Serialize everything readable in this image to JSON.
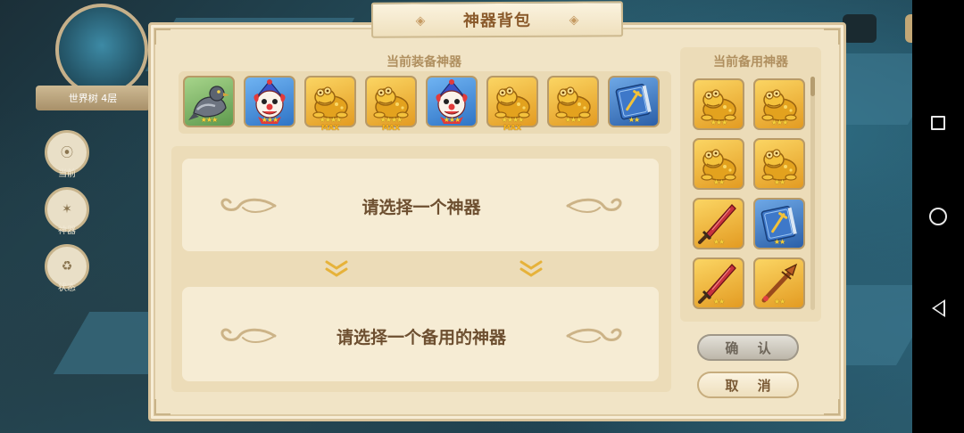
{
  "panel": {
    "title": "神器背包",
    "equipped_title": "当前装备神器",
    "spare_title": "当前备用神器"
  },
  "hud": {
    "minimap_label": "世界树 4层",
    "side_buttons": [
      "当前",
      "神器",
      "状态"
    ]
  },
  "equipped": [
    {
      "icon": "pigeon-icon",
      "stars": "★★★",
      "max": ""
    },
    {
      "icon": "clown-icon",
      "stars": "★★★",
      "max": ""
    },
    {
      "icon": "golden-toad-icon",
      "stars": "★★★★",
      "max": "MAX"
    },
    {
      "icon": "golden-toad-icon",
      "stars": "★★★★",
      "max": "MAX"
    },
    {
      "icon": "clown-icon",
      "stars": "★★★",
      "max": ""
    },
    {
      "icon": "golden-toad-icon",
      "stars": "★★★★",
      "max": "MAX"
    },
    {
      "icon": "golden-toad-icon",
      "stars": "★★★",
      "max": ""
    },
    {
      "icon": "spellbook-icon",
      "stars": "★★",
      "max": ""
    }
  ],
  "spare": [
    {
      "icon": "golden-toad-icon",
      "stars": "★★★"
    },
    {
      "icon": "golden-toad-icon",
      "stars": "★★★"
    },
    {
      "icon": "golden-toad-icon",
      "stars": "★★"
    },
    {
      "icon": "golden-toad-icon",
      "stars": "★★"
    },
    {
      "icon": "red-sword-icon",
      "stars": "★★"
    },
    {
      "icon": "spellbook-icon",
      "stars": "★★"
    },
    {
      "icon": "red-sword-icon",
      "stars": "★★"
    },
    {
      "icon": "spear-icon",
      "stars": "★★"
    }
  ],
  "messages": {
    "select_artifact": "请选择一个神器",
    "select_spare": "请选择一个备用的神器"
  },
  "buttons": {
    "confirm": "确 认",
    "cancel": "取 消"
  },
  "colors": {
    "panel_bg": "#f1e4c6",
    "title_text": "#8a5a2b",
    "section_text": "#b09060",
    "gold_slot": "#f2b733",
    "blue_slot": "#3f8fd6",
    "green_slot": "#5aa86a"
  }
}
